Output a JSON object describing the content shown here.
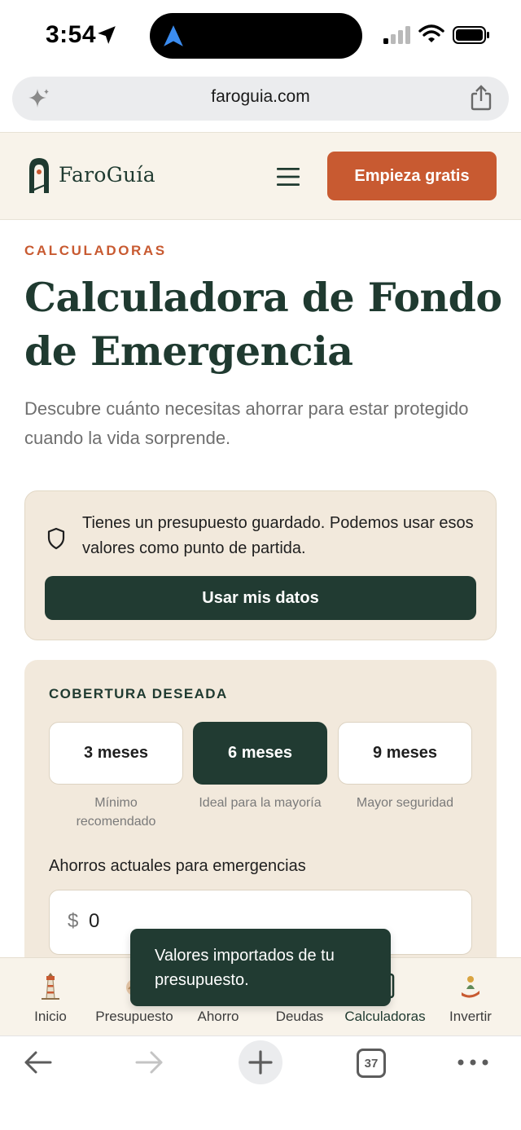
{
  "status_bar": {
    "time": "3:54"
  },
  "browser": {
    "url": "faroguia.com",
    "tab_count": "37"
  },
  "header": {
    "logo_text": "FaroGuía",
    "cta_label": "Empieza gratis"
  },
  "main": {
    "eyebrow": "CALCULADORAS",
    "title": "Calculadora de Fondo de Emergencia",
    "subtitle": "Descubre cuánto necesitas ahorrar para estar protegido cuando la vida sorprende."
  },
  "notice": {
    "text": "Tienes un presupuesto guardado. Podemos usar esos valores como punto de partida.",
    "button_label": "Usar mis datos"
  },
  "calculator": {
    "coverage_label": "COBERTURA DESEADA",
    "options": [
      {
        "label": "3 meses",
        "caption": "Mínimo recomendado",
        "selected": false
      },
      {
        "label": "6 meses",
        "caption": "Ideal para la mayoría",
        "selected": true
      },
      {
        "label": "9 meses",
        "caption": "Mayor seguridad",
        "selected": false
      }
    ],
    "savings_label": "Ahorros actuales para emergencias",
    "currency_symbol": "$",
    "savings_value": "0"
  },
  "toast": {
    "text": "Valores importados de tu presupuesto."
  },
  "bottom_nav": {
    "items": [
      {
        "label": "Inicio",
        "icon": "lighthouse-icon"
      },
      {
        "label": "Presupuesto",
        "icon": "budget-icon"
      },
      {
        "label": "Ahorro",
        "icon": "savings-icon"
      },
      {
        "label": "Deudas",
        "icon": "debts-icon"
      },
      {
        "label": "Calculadoras",
        "icon": "calculator-icon",
        "active": true
      },
      {
        "label": "Invertir",
        "icon": "invest-icon"
      }
    ]
  },
  "colors": {
    "brand_green": "#213b32",
    "accent_orange": "#c85a31",
    "cream": "#f8f3ea",
    "card_beige": "#f2e9dc"
  }
}
